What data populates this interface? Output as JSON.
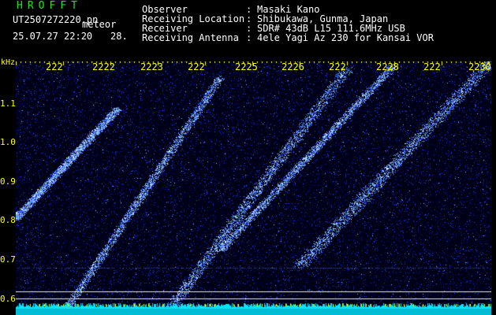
{
  "header": {
    "app_title": "HROFFT",
    "filename": "UT2507272220.pn",
    "meteor_tag": "meteor",
    "datetime": "25.07.27 22:20",
    "extra_value": "28."
  },
  "info": [
    {
      "label": "Observer",
      "value": "Masaki Kano"
    },
    {
      "label": "Receiving Location",
      "value": "Shibukawa, Gunma, Japan"
    },
    {
      "label": "Receiver",
      "value": "SDR# 43dB L15 111.6MHz USB"
    },
    {
      "label": "Receiving Antenna",
      "value": "4ele Yagi Az 230 for Kansai VOR"
    }
  ],
  "colon": ":",
  "axis": {
    "y_unit": "kHz",
    "y_ticks": [
      "1.1",
      "1.0",
      "0.9",
      "0.8",
      "0.7",
      "0.6"
    ],
    "x_ticks": [
      "222",
      "2222",
      "2223",
      "222",
      "2225",
      "2226",
      "222",
      "2228",
      "222",
      "2230"
    ]
  },
  "colors": {
    "background": "#000000",
    "tick_label": "#ffff00",
    "title": "#22e022",
    "trail": "#7fb8ff",
    "noise": "#1c38d8",
    "bottom_band": "#00e5ff"
  }
}
